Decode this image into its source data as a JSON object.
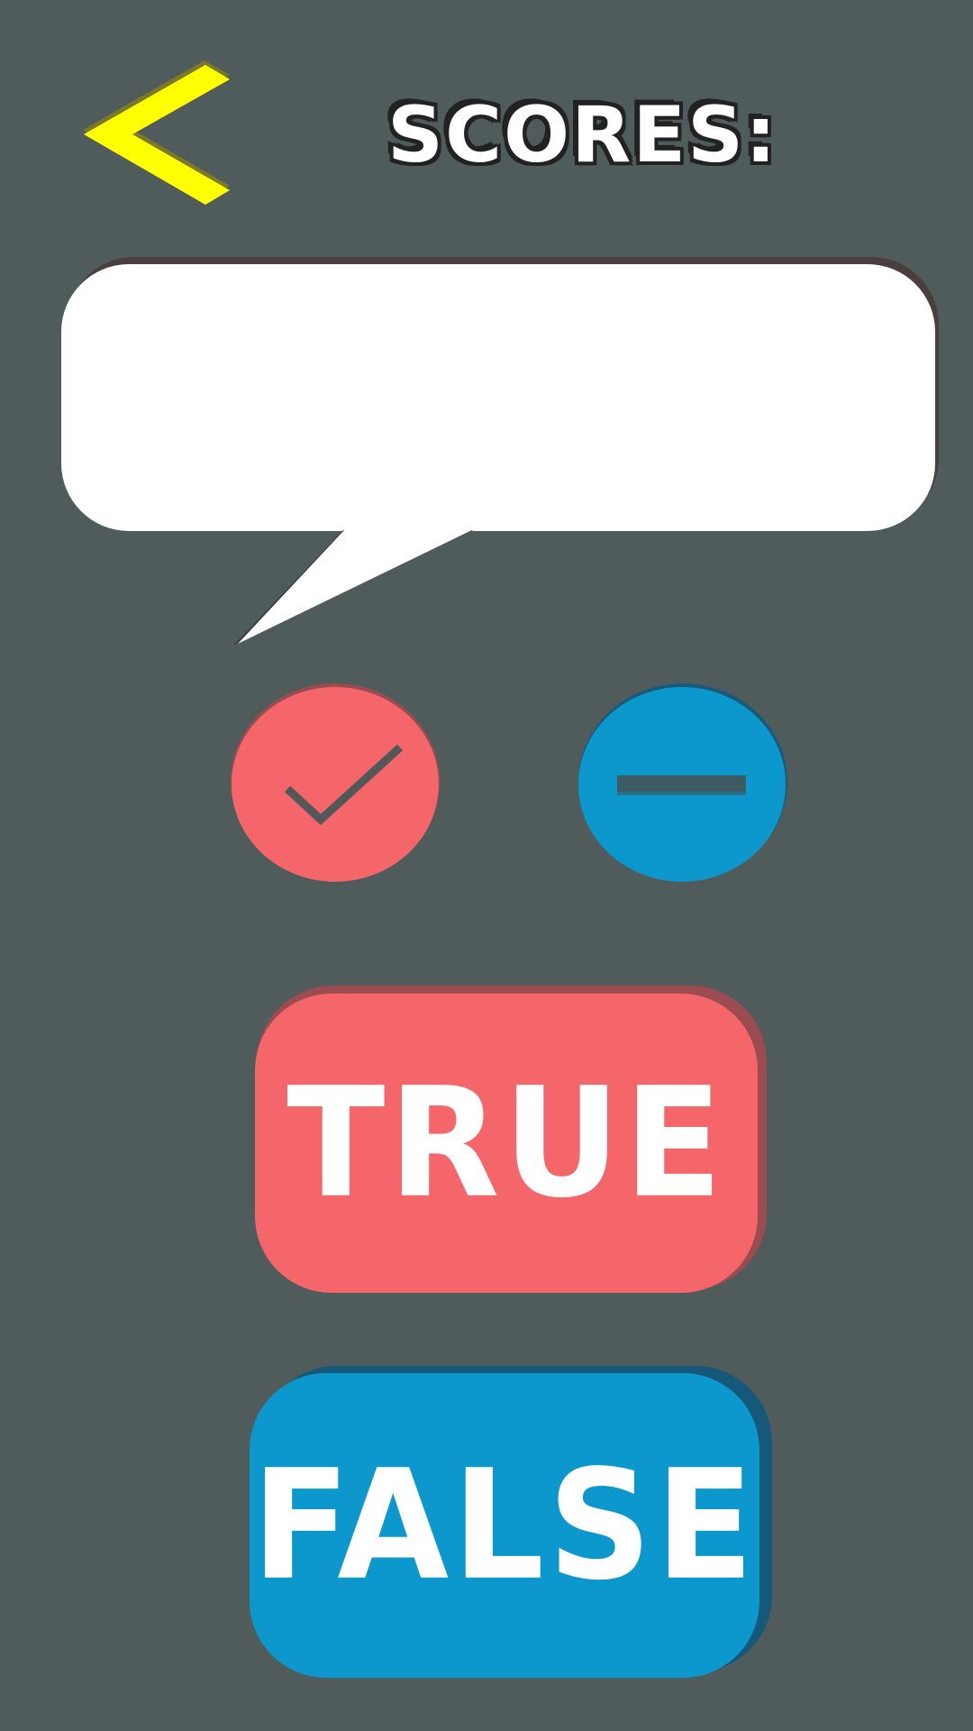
{
  "header": {
    "back_icon": "chevron-left-icon",
    "title": "SCORES:",
    "score": ""
  },
  "question": {
    "text": ""
  },
  "icons": {
    "correct": "check-icon",
    "neutral": "minus-icon"
  },
  "answers": {
    "true_label": "TRUE",
    "false_label": "FALSE"
  },
  "colors": {
    "background": "#505c5c",
    "back_arrow": "#ffff00",
    "true_red": "#f4666a",
    "false_blue": "#0c98cc",
    "bubble": "#ffffff",
    "text": "#ffffff"
  }
}
